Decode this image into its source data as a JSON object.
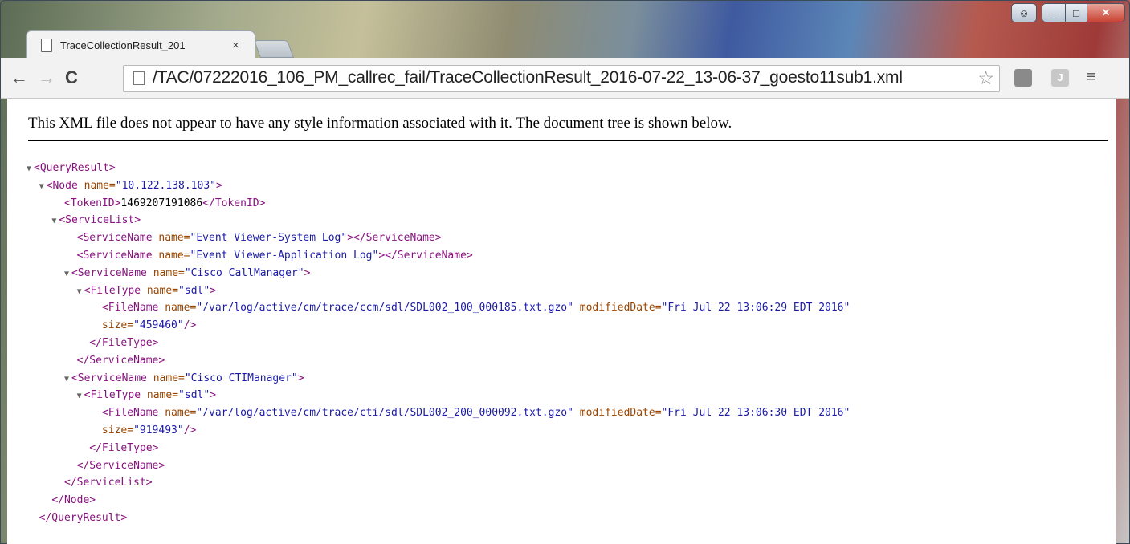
{
  "window": {
    "tab_title": "TraceCollectionResult_201",
    "tab_close": "×",
    "controls": {
      "profile": "☺",
      "min": "—",
      "max": "□",
      "close": "✕"
    }
  },
  "toolbar": {
    "back": "←",
    "forward": "→",
    "reload": "C",
    "url": "/TAC/07222016_106_PM_callrec_fail/TraceCollectionResult_2016-07-22_13-06-37_goesto11sub1.xml",
    "star": "☆",
    "ext2": "J",
    "menu": "≡"
  },
  "page": {
    "notice": "This XML file does not appear to have any style information associated with it. The document tree is shown below."
  },
  "xml": {
    "l1": {
      "arrow": "▼",
      "tag": "<QueryResult>"
    },
    "l2": {
      "arrow": "▼",
      "open": "<Node ",
      "a1": "name=",
      "v1": "\"10.122.138.103\"",
      "close": ">"
    },
    "l3": {
      "open": "<TokenID>",
      "text": "1469207191086",
      "close": "</TokenID>"
    },
    "l4": {
      "arrow": "▼",
      "tag": "<ServiceList>"
    },
    "l5": {
      "open": "<ServiceName ",
      "a1": "name=",
      "v1": "\"Event Viewer-System Log\"",
      "close": "></ServiceName>"
    },
    "l6": {
      "open": "<ServiceName ",
      "a1": "name=",
      "v1": "\"Event Viewer-Application Log\"",
      "close": "></ServiceName>"
    },
    "l7": {
      "arrow": "▼",
      "open": "<ServiceName ",
      "a1": "name=",
      "v1": "\"Cisco CallManager\"",
      "close": ">"
    },
    "l8": {
      "arrow": "▼",
      "open": "<FileType ",
      "a1": "name=",
      "v1": "\"sdl\"",
      "close": ">"
    },
    "l9": {
      "open": "<FileName ",
      "a1": "name=",
      "v1": "\"/var/log/active/cm/trace/ccm/sdl/SDL002_100_000185.txt.gzo\"",
      "a2": " modifiedDate=",
      "v2": "\"Fri Jul 22 13:06:29 EDT 2016\""
    },
    "l10": {
      "a3": "size=",
      "v3": "\"459460\"",
      "close": "/>"
    },
    "l11": {
      "tag": "</FileType>"
    },
    "l12": {
      "tag": "</ServiceName>"
    },
    "l13": {
      "arrow": "▼",
      "open": "<ServiceName ",
      "a1": "name=",
      "v1": "\"Cisco CTIManager\"",
      "close": ">"
    },
    "l14": {
      "arrow": "▼",
      "open": "<FileType ",
      "a1": "name=",
      "v1": "\"sdl\"",
      "close": ">"
    },
    "l15": {
      "open": "<FileName ",
      "a1": "name=",
      "v1": "\"/var/log/active/cm/trace/cti/sdl/SDL002_200_000092.txt.gzo\"",
      "a2": " modifiedDate=",
      "v2": "\"Fri Jul 22 13:06:30 EDT 2016\""
    },
    "l16": {
      "a3": "size=",
      "v3": "\"919493\"",
      "close": "/>"
    },
    "l17": {
      "tag": "</FileType>"
    },
    "l18": {
      "tag": "</ServiceName>"
    },
    "l19": {
      "tag": "</ServiceList>"
    },
    "l20": {
      "tag": "</Node>"
    },
    "l21": {
      "tag": "</QueryResult>"
    }
  },
  "colors": {
    "tag": "#881280",
    "attribute": "#994500",
    "value": "#1a1aa6"
  }
}
